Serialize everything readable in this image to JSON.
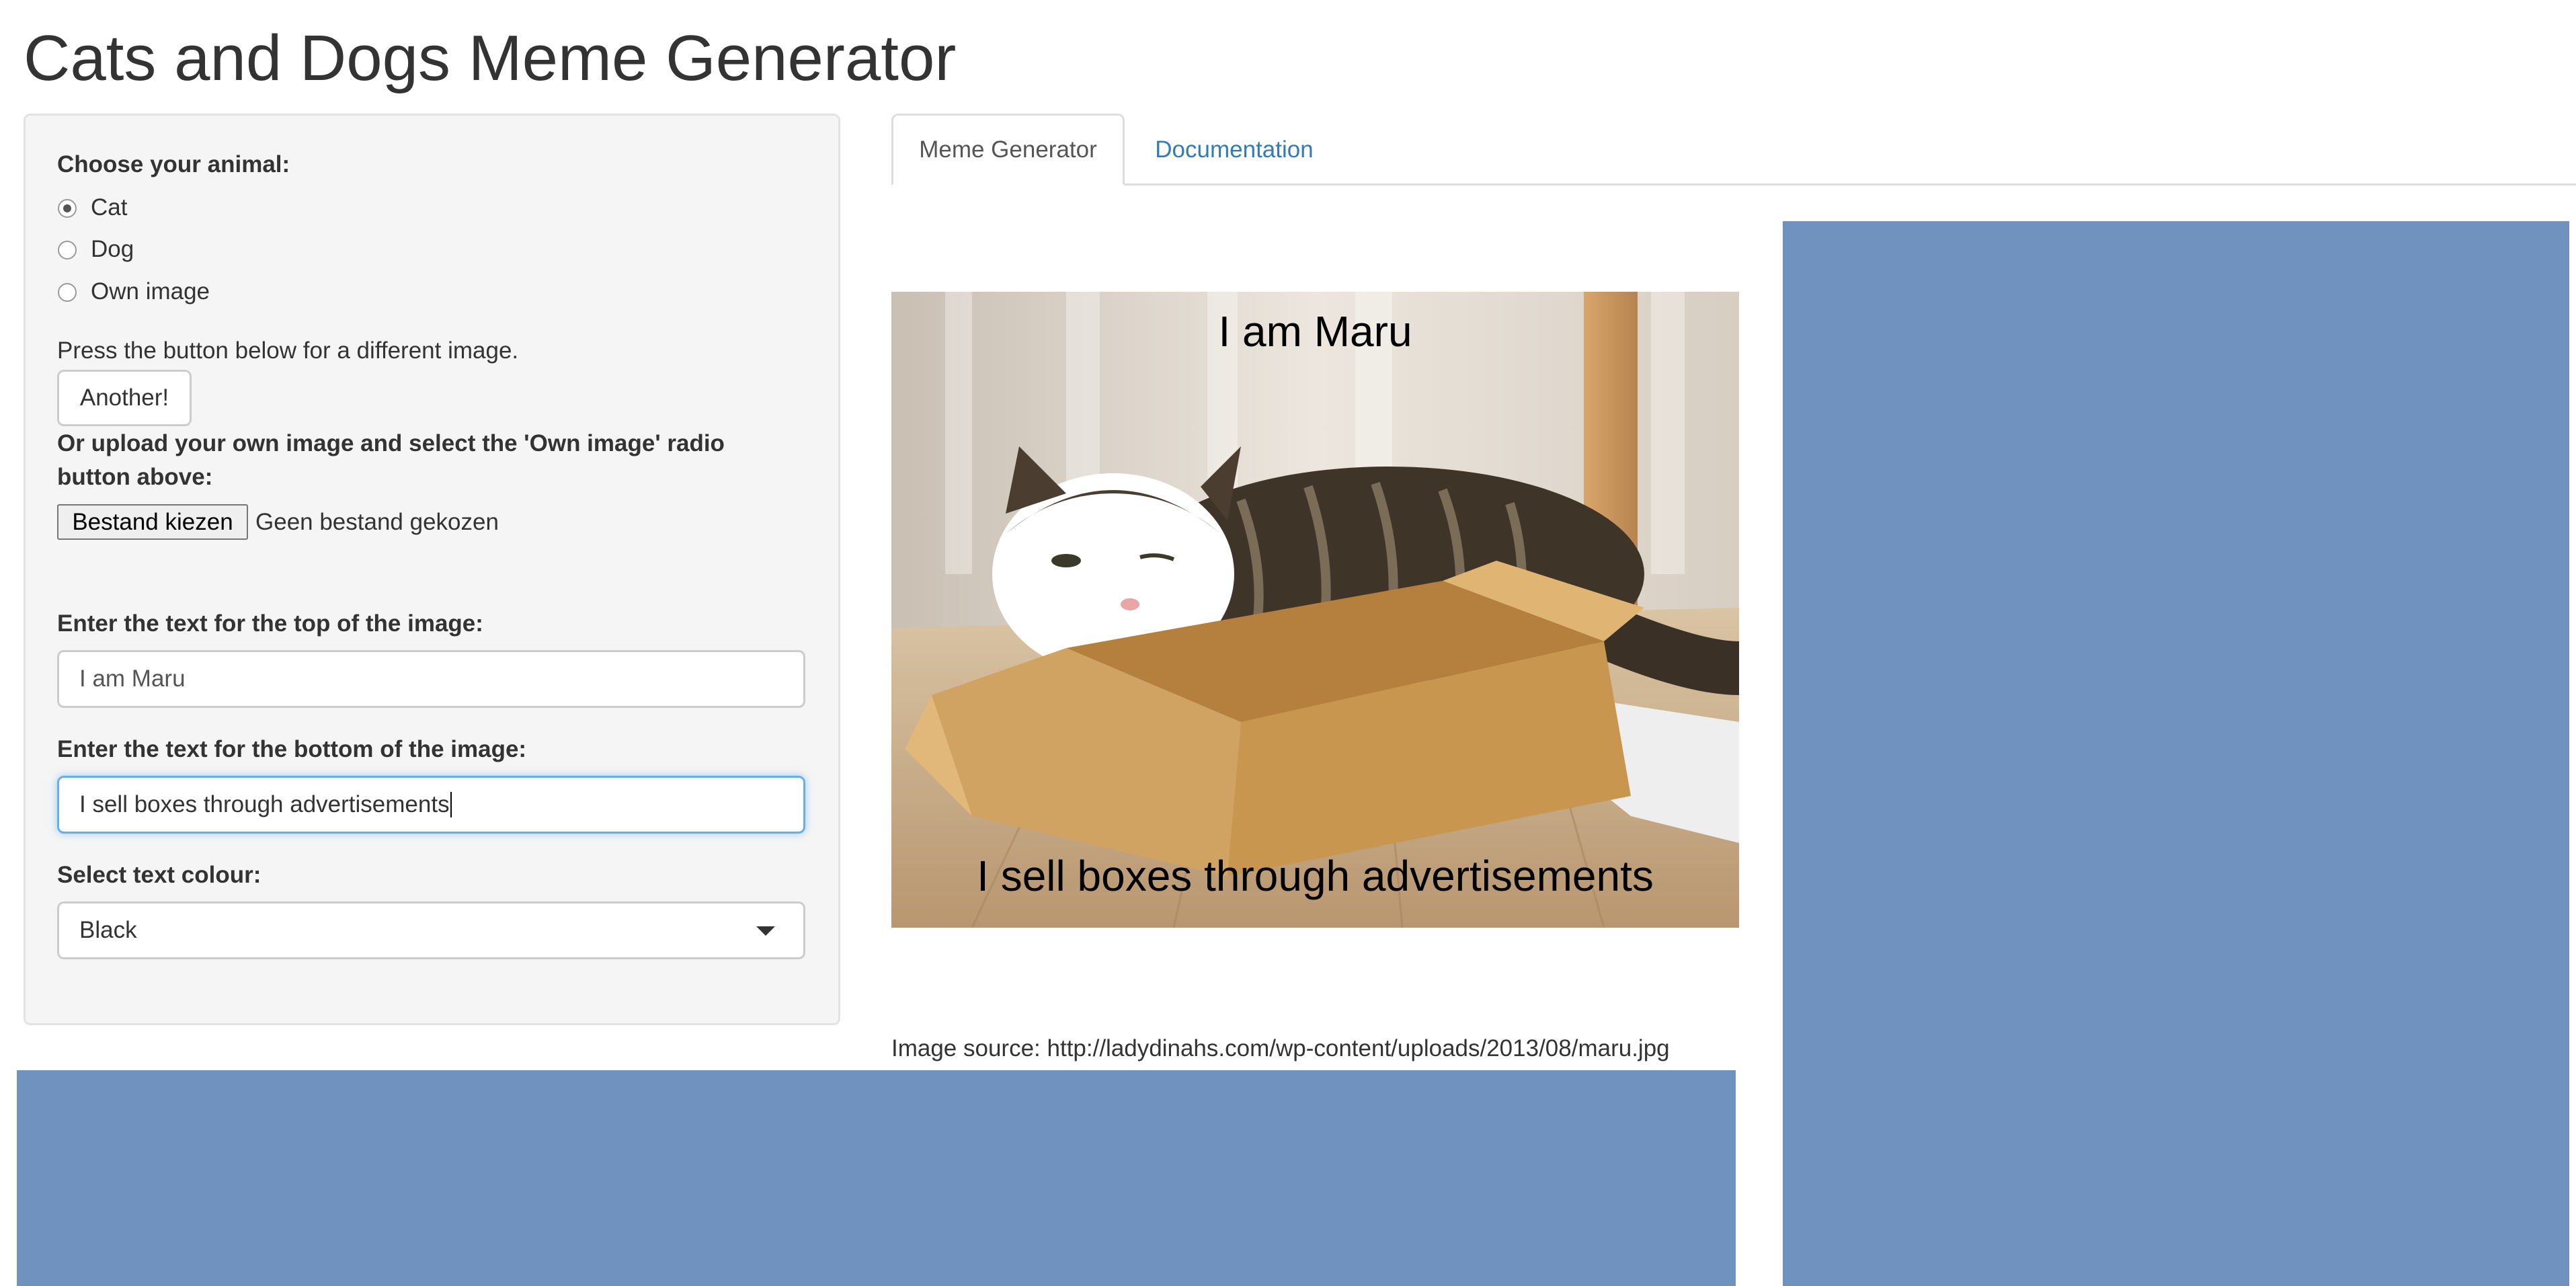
{
  "page": {
    "title": "Cats and Dogs Meme Generator"
  },
  "sidebar": {
    "animal_label": "Choose your animal:",
    "animal_options": [
      "Cat",
      "Dog",
      "Own image"
    ],
    "animal_selected": "Cat",
    "another_hint": "Press the button below for a different image.",
    "another_button": "Another!",
    "upload_label": "Or upload your own image and select the 'Own image' radio button above:",
    "upload_label_line1": "Or upload your own image and select the 'Own image' radio",
    "upload_label_line2": "button above:",
    "file_button": "Bestand kiezen",
    "file_status": "Geen bestand gekozen",
    "top_text_label": "Enter the text for the top of the image:",
    "top_text_value": "I am Maru",
    "bottom_text_label": "Enter the text for the bottom of the image:",
    "bottom_text_value": "I sell boxes through advertisements",
    "colour_label": "Select text colour:",
    "colour_value": "Black"
  },
  "tabs": [
    {
      "label": "Meme Generator",
      "active": true
    },
    {
      "label": "Documentation",
      "active": false
    }
  ],
  "meme": {
    "top_text": "I am Maru",
    "bottom_text": "I sell boxes through advertisements",
    "text_color": "#000000"
  },
  "image_source": "Image source: http://ladydinahs.com/wp-content/uploads/2013/08/maru.jpg",
  "colors": {
    "accent_link": "#337ab7",
    "focus_border": "#66afe9",
    "placeholder_block": "#7092bf",
    "panel_bg": "#f5f5f5"
  }
}
